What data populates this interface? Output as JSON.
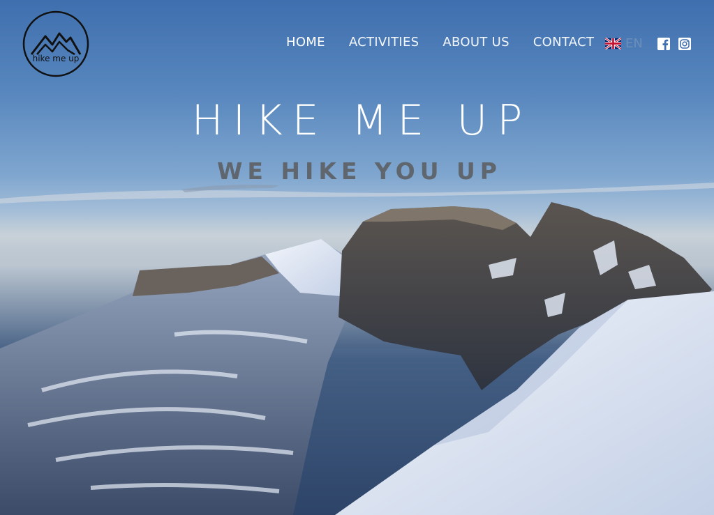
{
  "brand": {
    "logo_text": "hike me up"
  },
  "nav": {
    "items": [
      {
        "label": "HOME",
        "active": true
      },
      {
        "label": "ACTIVITIES",
        "active": false
      },
      {
        "label": "ABOUT US",
        "active": false
      },
      {
        "label": "CONTACT",
        "active": false
      }
    ]
  },
  "language": {
    "code": "EN",
    "flag_icon": "uk-flag-icon"
  },
  "social": {
    "icons": [
      "facebook-icon",
      "instagram-icon"
    ]
  },
  "hero": {
    "title": "HIKE ME UP",
    "subtitle": "WE HIKE YOU UP"
  },
  "colors": {
    "sky_top": "#3f6fae",
    "text_light": "#ffffff",
    "subtitle_gray": "#60666e",
    "snow": "#e8edf6"
  }
}
